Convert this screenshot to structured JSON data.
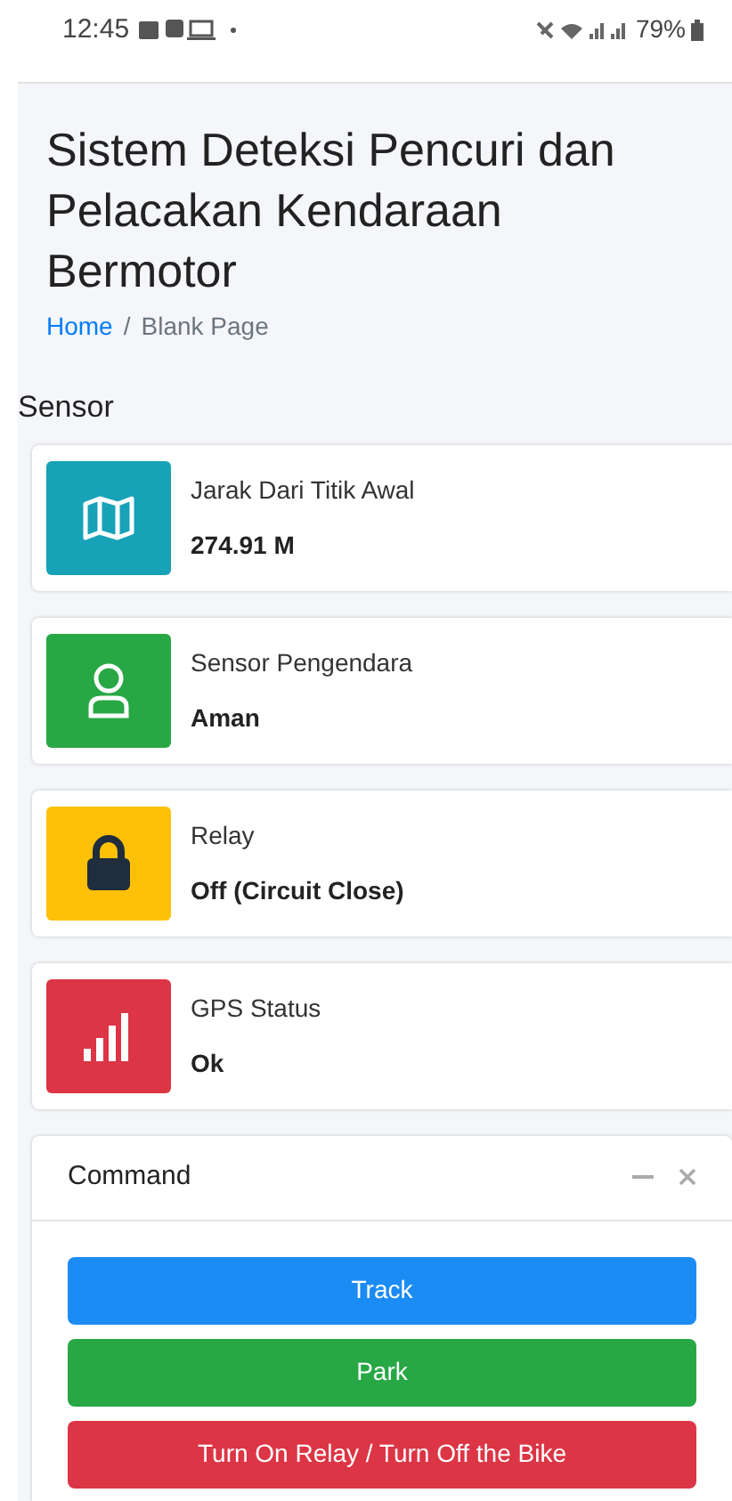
{
  "status_bar": {
    "time": "12:45",
    "battery": "79%"
  },
  "page": {
    "title": "Sistem Deteksi Pencuri dan Pelacakan Kendaraan Bermotor",
    "breadcrumb_separator": "/",
    "breadcrumb": [
      {
        "label": "Home",
        "selected": false
      },
      {
        "label": "Blank Page",
        "selected": true
      }
    ]
  },
  "section": "Sensor",
  "cards": [
    {
      "kind": "map",
      "color": "#17a2b8",
      "label": "Jarak Dari Titik Awal",
      "value": "274.91 M"
    },
    {
      "kind": "user",
      "color": "#28a745",
      "label": "Sensor Pengendara",
      "value": "Aman"
    },
    {
      "kind": "lock",
      "color": "#ffc107",
      "label": "Relay",
      "value": "Off (Circuit Close)"
    },
    {
      "kind": "signal",
      "color": "#dc3545",
      "label": "GPS Status",
      "value": "Ok"
    }
  ],
  "command": {
    "title": "Command",
    "buttons": [
      {
        "kind": "primary",
        "label": "Track"
      },
      {
        "kind": "success",
        "label": "Park"
      },
      {
        "kind": "danger",
        "label": "Turn On Relay / Turn Off the Bike"
      }
    ]
  }
}
